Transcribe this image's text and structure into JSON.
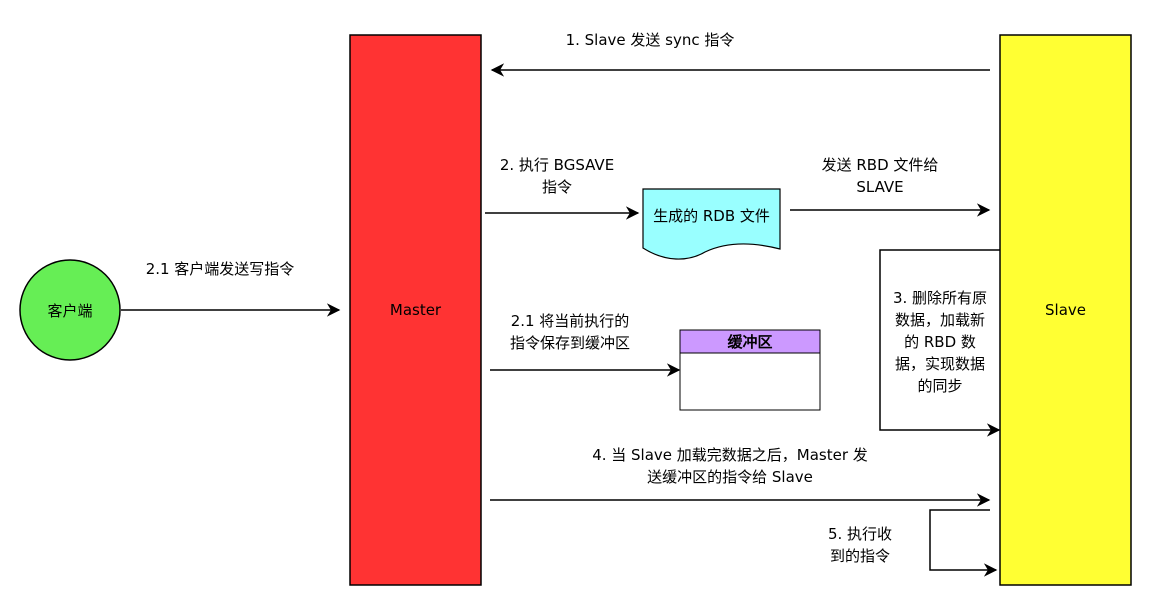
{
  "nodes": {
    "master": {
      "label": "Master",
      "color": "#ff3333"
    },
    "slave": {
      "label": "Slave",
      "color": "#ffff33"
    },
    "client": {
      "label": "客户端",
      "color": "#66ee55"
    },
    "rdb_file": {
      "label": "生成的 RDB 文件",
      "color": "#99ffff"
    },
    "buffer": {
      "label": "缓冲区",
      "header_color": "#cc99ff"
    }
  },
  "edges": {
    "sync": [
      "1. Slave 发送 sync 指令"
    ],
    "bgsave": [
      "2. 执行 BGSAVE",
      "指令"
    ],
    "send_rbd": [
      "发送 RBD 文件给",
      "SLAVE"
    ],
    "client_write": [
      "2.1 客户端发送写指令"
    ],
    "save_buffer": [
      "2.1 将当前执行的",
      "指令保存到缓冲区"
    ],
    "delete_load": [
      "3. 删除所有原",
      "数据，加载新",
      "的 RBD 数",
      "据，实现数据",
      "的同步"
    ],
    "send_buffer": [
      "4. 当 Slave 加载完数据之后，Master 发",
      "送缓冲区的指令给 Slave"
    ],
    "exec_recv": [
      "5. 执行收",
      "到的指令"
    ]
  }
}
